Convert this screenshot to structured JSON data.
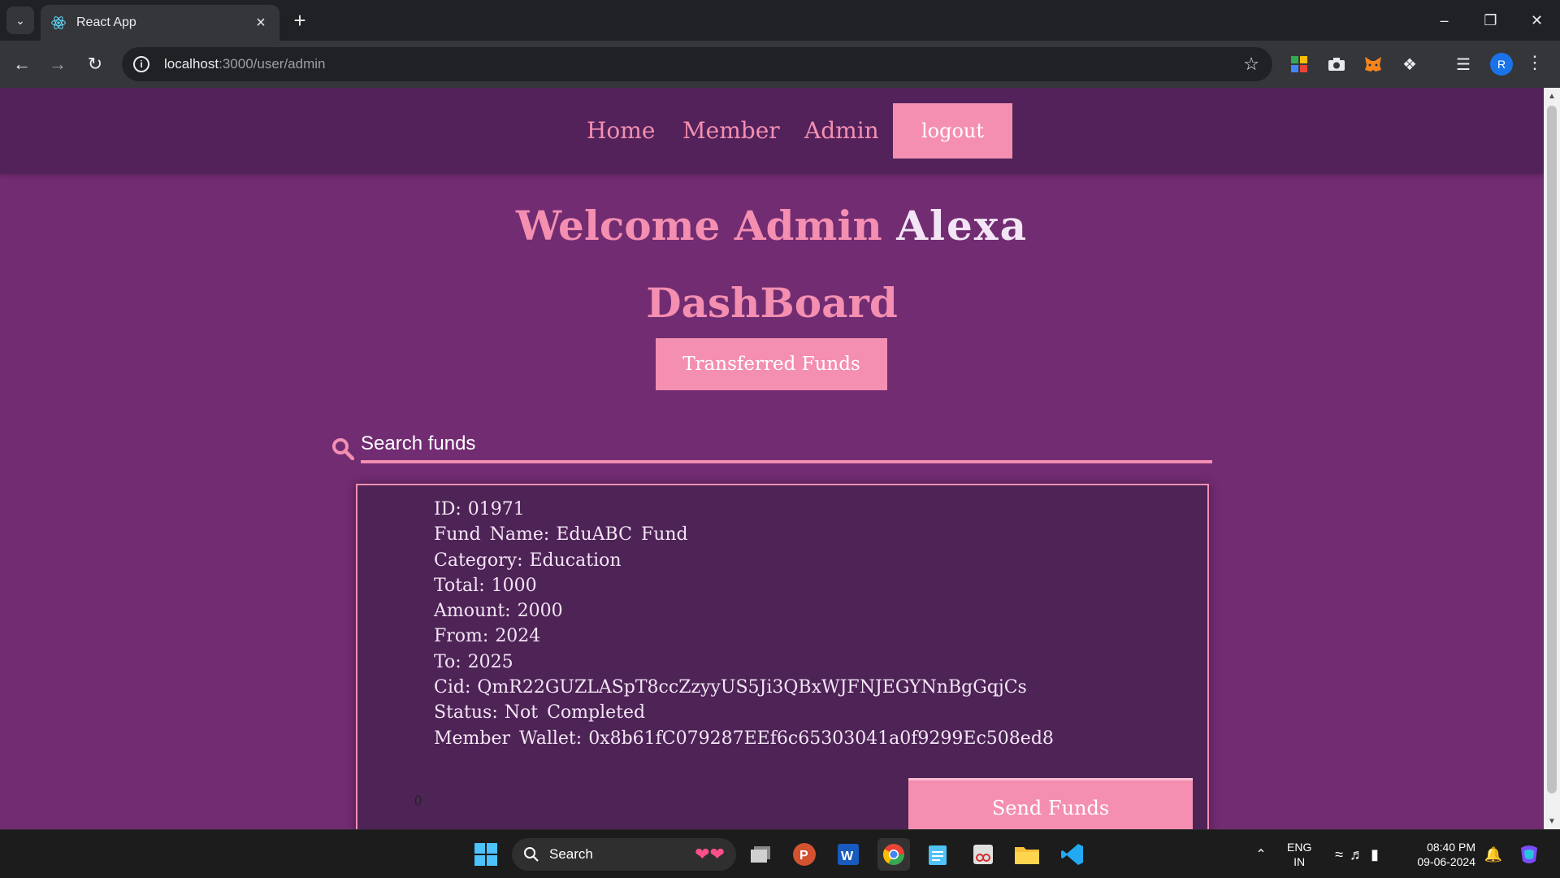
{
  "browser": {
    "tab_title": "React App",
    "url_host": "localhost",
    "url_path": ":3000/user/admin",
    "profile_initial": "R"
  },
  "navbar": {
    "home": "Home",
    "member": "Member",
    "admin": "Admin",
    "logout": "logout"
  },
  "welcome": {
    "prefix": "Welcome Admin",
    "name": "Alexa"
  },
  "dashboard_title": "DashBoard",
  "transferred_button": "Transferred Funds",
  "search": {
    "placeholder": "Search funds"
  },
  "fund": {
    "lines": [
      {
        "label": "ID:",
        "value": "01971"
      },
      {
        "label": "Fund Name:",
        "value": "EduABC Fund"
      },
      {
        "label": "Category:",
        "value": "Education"
      },
      {
        "label": "Total:",
        "value": "1000"
      },
      {
        "label": "Amount:",
        "value": "2000"
      },
      {
        "label": "From:",
        "value": "2024"
      },
      {
        "label": "To:",
        "value": "2025"
      },
      {
        "label": "Cid:",
        "value": "QmR22GUZLASpT8ccZzyyUS5Ji3QBxWJFNJEGYNnBgGqjCs"
      },
      {
        "label": "Status:",
        "value": "Not Completed"
      },
      {
        "label": "Member Wallet:",
        "value": "0x8b61fC079287EEf6c65303041a0f9299Ec508ed8"
      }
    ],
    "paren_text": "()",
    "send_button": "Send Funds"
  },
  "taskbar": {
    "search_label": "Search",
    "lang_line1": "ENG",
    "lang_line2": "IN",
    "time": "08:40 PM",
    "date": "09-06-2024"
  },
  "colors": {
    "page_bg": "#722c72",
    "navbar_bg": "#53225b",
    "accent_pink": "#f48fb1",
    "card_bg": "#4e2356"
  }
}
